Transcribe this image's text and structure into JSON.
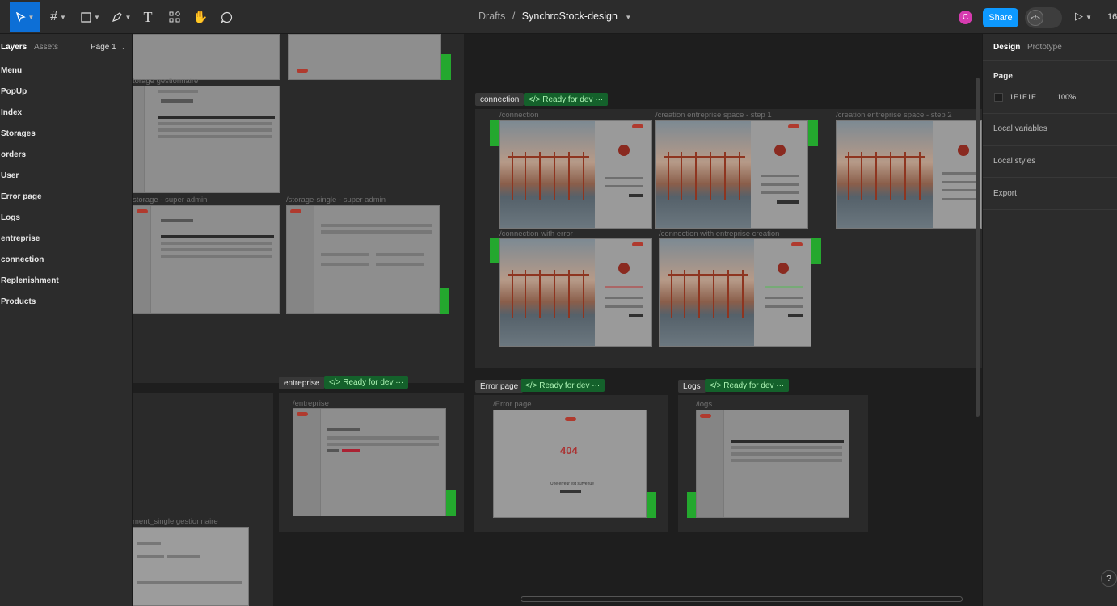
{
  "toolbar": {
    "breadcrumb_folder": "Drafts",
    "breadcrumb_separator": "/",
    "file_name": "SynchroStock-design",
    "avatar_initial": "C",
    "share_label": "Share",
    "dev_mode_glyph": "</>",
    "present_glyph": "▷",
    "zoom_text": "16",
    "tools": [
      "move-tool",
      "frame-tool",
      "shape-tool",
      "pen-tool",
      "text-tool",
      "resources-tool",
      "hand-tool",
      "comment-tool"
    ]
  },
  "left_panel": {
    "tab_layers": "Layers",
    "tab_assets": "Assets",
    "page_selector": "Page 1",
    "layers": [
      "Menu",
      "PopUp",
      "Index",
      "Storages",
      "orders",
      "User",
      "Error page",
      "Logs",
      "entreprise",
      "connection",
      "Replenishment",
      "Products"
    ]
  },
  "canvas": {
    "labels": {
      "storage_gestionnaire": "torage gestionnaire",
      "storage_super_admin": "storage - super admin",
      "storage_single_super_admin": "/storage-single - super admin",
      "replenishment_single": "ment_single gestionnaire",
      "connection_frame": "/connection",
      "creation_step1": "/creation entreprise space - step 1",
      "creation_step2": "/creation entreprise space - step 2",
      "connection_error": "/connection with error",
      "connection_creation": "/connection with entreprise creation",
      "entreprise_frame": "/entreprise",
      "error_frame": "/Error page",
      "logs_frame": "/logs"
    },
    "sections": {
      "connection": "connection",
      "entreprise": "entreprise",
      "error_page": "Error page",
      "logs": "Logs"
    },
    "status_badge": "</> Ready for dev ···",
    "error_404_text": "404",
    "error_message": "Une erreur est survenue"
  },
  "right_panel": {
    "tab_design": "Design",
    "tab_prototype": "Prototype",
    "page_heading": "Page",
    "page_color": "1E1E1E",
    "page_opacity": "100%",
    "local_variables": "Local variables",
    "local_styles": "Local styles",
    "export": "Export"
  },
  "help_glyph": "?"
}
